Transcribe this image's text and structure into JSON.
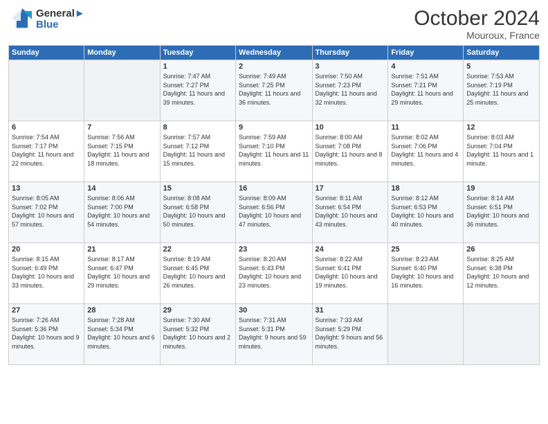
{
  "header": {
    "logo_line1": "General",
    "logo_line2": "Blue",
    "month_title": "October 2024",
    "location": "Mouroux, France"
  },
  "columns": [
    "Sunday",
    "Monday",
    "Tuesday",
    "Wednesday",
    "Thursday",
    "Friday",
    "Saturday"
  ],
  "weeks": [
    [
      {
        "day": "",
        "info": ""
      },
      {
        "day": "",
        "info": ""
      },
      {
        "day": "1",
        "info": "Sunrise: 7:47 AM\nSunset: 7:27 PM\nDaylight: 11 hours and 39 minutes."
      },
      {
        "day": "2",
        "info": "Sunrise: 7:49 AM\nSunset: 7:25 PM\nDaylight: 11 hours and 36 minutes."
      },
      {
        "day": "3",
        "info": "Sunrise: 7:50 AM\nSunset: 7:23 PM\nDaylight: 11 hours and 32 minutes."
      },
      {
        "day": "4",
        "info": "Sunrise: 7:51 AM\nSunset: 7:21 PM\nDaylight: 11 hours and 29 minutes."
      },
      {
        "day": "5",
        "info": "Sunrise: 7:53 AM\nSunset: 7:19 PM\nDaylight: 11 hours and 25 minutes."
      }
    ],
    [
      {
        "day": "6",
        "info": "Sunrise: 7:54 AM\nSunset: 7:17 PM\nDaylight: 11 hours and 22 minutes."
      },
      {
        "day": "7",
        "info": "Sunrise: 7:56 AM\nSunset: 7:15 PM\nDaylight: 11 hours and 18 minutes."
      },
      {
        "day": "8",
        "info": "Sunrise: 7:57 AM\nSunset: 7:12 PM\nDaylight: 11 hours and 15 minutes."
      },
      {
        "day": "9",
        "info": "Sunrise: 7:59 AM\nSunset: 7:10 PM\nDaylight: 11 hours and 11 minutes."
      },
      {
        "day": "10",
        "info": "Sunrise: 8:00 AM\nSunset: 7:08 PM\nDaylight: 11 hours and 8 minutes."
      },
      {
        "day": "11",
        "info": "Sunrise: 8:02 AM\nSunset: 7:06 PM\nDaylight: 11 hours and 4 minutes."
      },
      {
        "day": "12",
        "info": "Sunrise: 8:03 AM\nSunset: 7:04 PM\nDaylight: 11 hours and 1 minute."
      }
    ],
    [
      {
        "day": "13",
        "info": "Sunrise: 8:05 AM\nSunset: 7:02 PM\nDaylight: 10 hours and 57 minutes."
      },
      {
        "day": "14",
        "info": "Sunrise: 8:06 AM\nSunset: 7:00 PM\nDaylight: 10 hours and 54 minutes."
      },
      {
        "day": "15",
        "info": "Sunrise: 8:08 AM\nSunset: 6:58 PM\nDaylight: 10 hours and 50 minutes."
      },
      {
        "day": "16",
        "info": "Sunrise: 8:09 AM\nSunset: 6:56 PM\nDaylight: 10 hours and 47 minutes."
      },
      {
        "day": "17",
        "info": "Sunrise: 8:11 AM\nSunset: 6:54 PM\nDaylight: 10 hours and 43 minutes."
      },
      {
        "day": "18",
        "info": "Sunrise: 8:12 AM\nSunset: 6:53 PM\nDaylight: 10 hours and 40 minutes."
      },
      {
        "day": "19",
        "info": "Sunrise: 8:14 AM\nSunset: 6:51 PM\nDaylight: 10 hours and 36 minutes."
      }
    ],
    [
      {
        "day": "20",
        "info": "Sunrise: 8:15 AM\nSunset: 6:49 PM\nDaylight: 10 hours and 33 minutes."
      },
      {
        "day": "21",
        "info": "Sunrise: 8:17 AM\nSunset: 6:47 PM\nDaylight: 10 hours and 29 minutes."
      },
      {
        "day": "22",
        "info": "Sunrise: 8:19 AM\nSunset: 6:45 PM\nDaylight: 10 hours and 26 minutes."
      },
      {
        "day": "23",
        "info": "Sunrise: 8:20 AM\nSunset: 6:43 PM\nDaylight: 10 hours and 23 minutes."
      },
      {
        "day": "24",
        "info": "Sunrise: 8:22 AM\nSunset: 6:41 PM\nDaylight: 10 hours and 19 minutes."
      },
      {
        "day": "25",
        "info": "Sunrise: 8:23 AM\nSunset: 6:40 PM\nDaylight: 10 hours and 16 minutes."
      },
      {
        "day": "26",
        "info": "Sunrise: 8:25 AM\nSunset: 6:38 PM\nDaylight: 10 hours and 12 minutes."
      }
    ],
    [
      {
        "day": "27",
        "info": "Sunrise: 7:26 AM\nSunset: 5:36 PM\nDaylight: 10 hours and 9 minutes."
      },
      {
        "day": "28",
        "info": "Sunrise: 7:28 AM\nSunset: 5:34 PM\nDaylight: 10 hours and 6 minutes."
      },
      {
        "day": "29",
        "info": "Sunrise: 7:30 AM\nSunset: 5:32 PM\nDaylight: 10 hours and 2 minutes."
      },
      {
        "day": "30",
        "info": "Sunrise: 7:31 AM\nSunset: 5:31 PM\nDaylight: 9 hours and 59 minutes."
      },
      {
        "day": "31",
        "info": "Sunrise: 7:33 AM\nSunset: 5:29 PM\nDaylight: 9 hours and 56 minutes."
      },
      {
        "day": "",
        "info": ""
      },
      {
        "day": "",
        "info": ""
      }
    ]
  ]
}
